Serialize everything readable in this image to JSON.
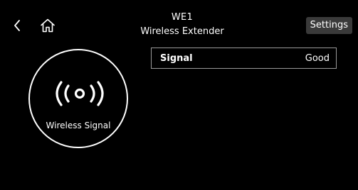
{
  "header": {
    "device_name": "WE1",
    "subtitle": "Wireless Extender",
    "settings_label": "Settings"
  },
  "status": {
    "circle_label": "Wireless Signal",
    "rows": [
      {
        "label": "Signal",
        "value": "Good"
      }
    ]
  },
  "icons": {
    "back": "chevron-left-icon",
    "home": "home-icon",
    "signal": "wireless-signal-icon"
  },
  "colors": {
    "background": "#000000",
    "text": "#ffffff",
    "button_bg": "#3a3a3a",
    "row_border": "#9a9a9a"
  }
}
